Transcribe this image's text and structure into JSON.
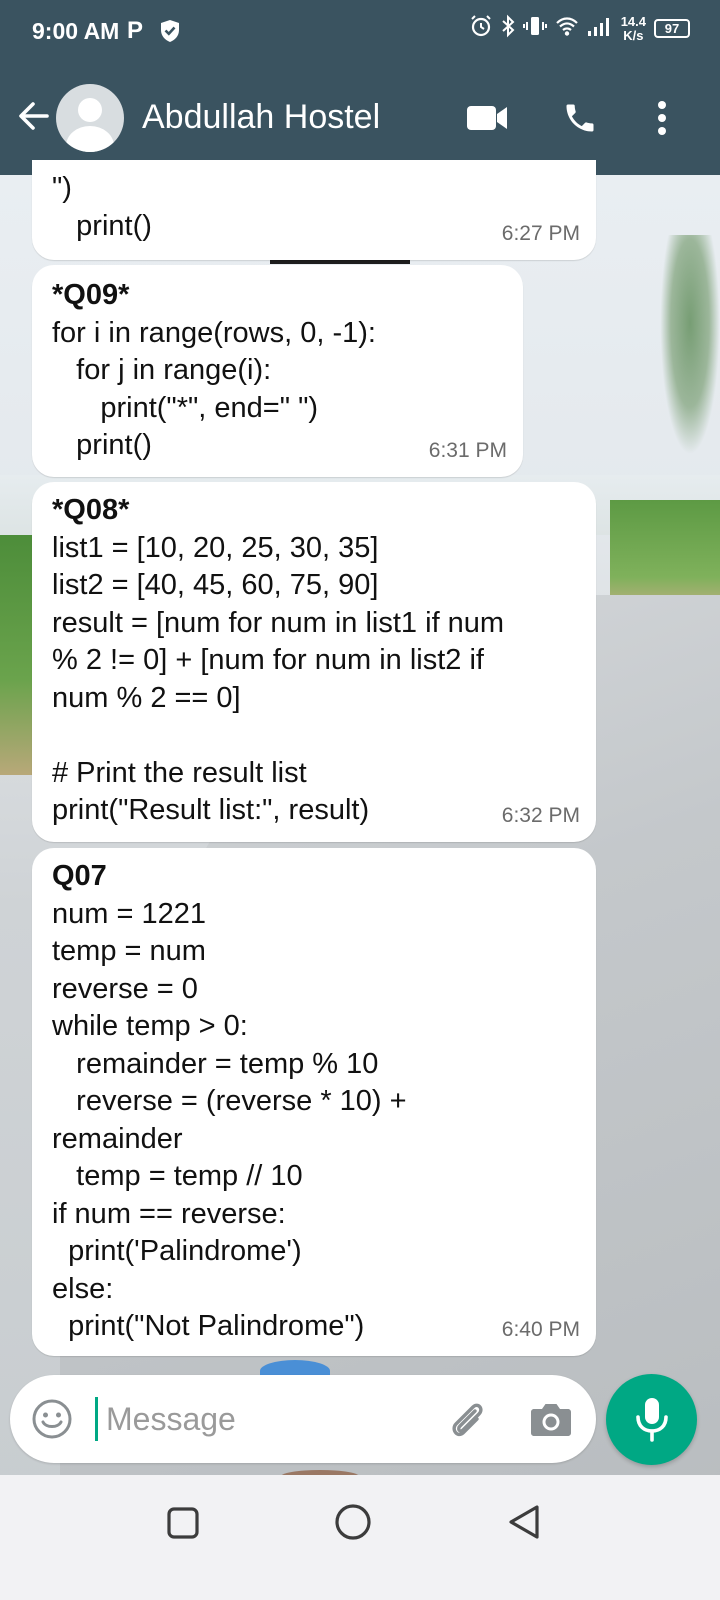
{
  "status_bar": {
    "time": "9:00 AM",
    "p_icon": "P",
    "speed_value": "14.4",
    "speed_unit": "K/s",
    "battery": "97"
  },
  "header": {
    "contact_name": "Abdullah Hostel"
  },
  "messages": [
    {
      "lines": "\")\n   print()",
      "time": "6:27 PM"
    },
    {
      "title": "*Q09*",
      "lines": "for i in range(rows, 0, -1):\n   for j in range(i):\n      print(\"*\", end=\" \")\n   print()",
      "time": "6:31 PM"
    },
    {
      "title": "*Q08*",
      "lines": "list1 = [10, 20, 25, 30, 35]\nlist2 = [40, 45, 60, 75, 90]\nresult = [num for num in list1 if num\n% 2 != 0] + [num for num in list2 if\nnum % 2 == 0]\n\n# Print the result list\nprint(\"Result list:\", result)",
      "time": "6:32 PM"
    },
    {
      "title": "Q07",
      "lines": "num = 1221\ntemp = num\nreverse = 0\nwhile temp > 0:\n   remainder = temp % 10\n   reverse = (reverse * 10) +\nremainder\n   temp = temp // 10\nif num == reverse:\n  print('Palindrome')\nelse:\n  print(\"Not Palindrome\")",
      "time": "6:40 PM"
    }
  ],
  "compose": {
    "placeholder": "Message",
    "value": ""
  },
  "icons": {
    "back": "arrow-left-icon",
    "video": "video-camera-icon",
    "call": "phone-icon",
    "menu": "more-vert-icon",
    "emoji": "emoji-icon",
    "attach": "paperclip-icon",
    "camera": "camera-icon",
    "mic": "mic-icon"
  },
  "colors": {
    "header": "#3a5360",
    "accent": "#00a884",
    "bubble": "#ffffff"
  }
}
